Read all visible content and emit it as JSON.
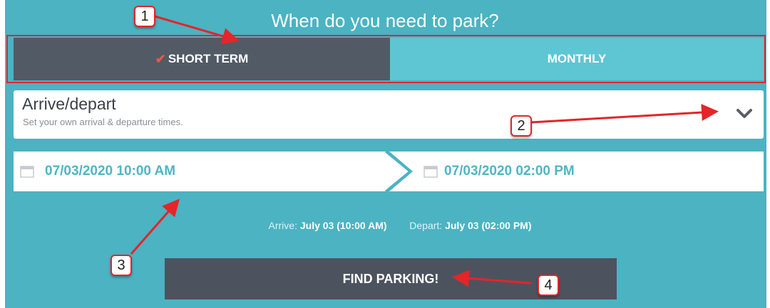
{
  "header": {
    "title": "When do you need to park?"
  },
  "tabs": [
    {
      "label": "SHORT TERM",
      "selected": true,
      "check": "✔"
    },
    {
      "label": "MONTHLY",
      "selected": false
    }
  ],
  "arrive_depart": {
    "title": "Arrive/depart",
    "subtitle": "Set your own arrival & departure times.",
    "icon": "chevron-down-icon"
  },
  "dates": {
    "arrive_value": "07/03/2020 10:00 AM",
    "depart_value": "07/03/2020 02:00 PM",
    "icon": "calendar-icon"
  },
  "summary": {
    "arrive_label": "Arrive:",
    "arrive_value": "July 03 (10:00 AM)",
    "depart_label": "Depart:",
    "depart_value": "July 03 (02:00 PM)"
  },
  "find_button": {
    "label": "FIND PARKING!"
  },
  "annotations": [
    {
      "label": "1"
    },
    {
      "label": "2"
    },
    {
      "label": "3"
    },
    {
      "label": "4"
    }
  ],
  "colors": {
    "panel": "#4bb3c2",
    "tab_selected": "#525a66",
    "tab_unselected": "#5ec6d3",
    "date_text": "#4fb6c3",
    "button": "#4d535e",
    "annotation": "#e4252a"
  }
}
